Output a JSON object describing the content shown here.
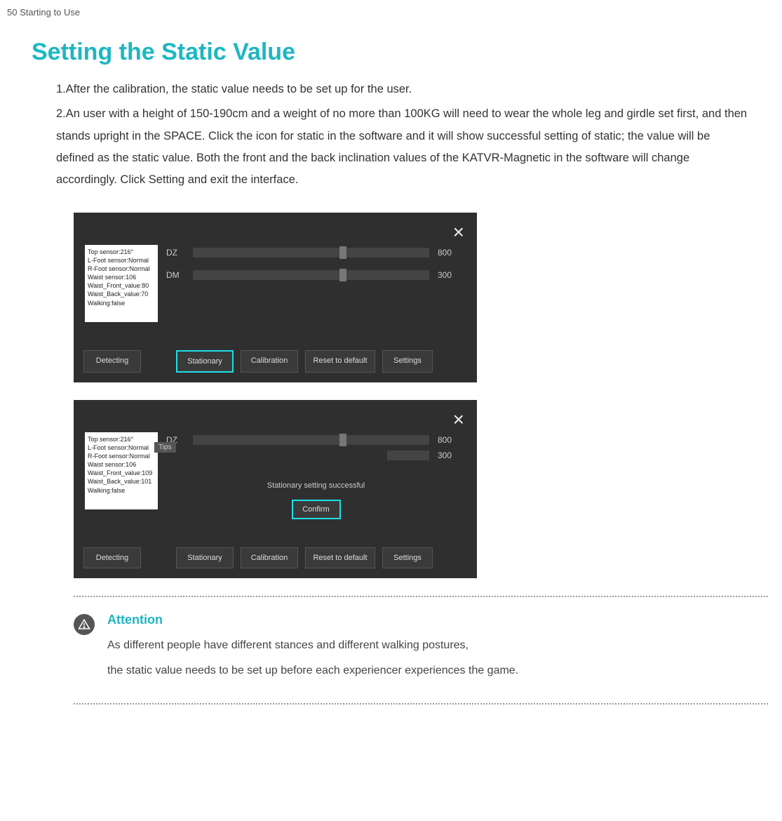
{
  "page_header": "50  Starting to Use",
  "title": "Setting the Static Value",
  "step1": "1.After the calibration, the static value needs to be set up for the user.",
  "step2": "2.An user with a height of 150-190cm and a weight of no more than 100KG will need to wear the whole leg and girdle set first, and then stands upright in the SPACE. Click the icon for static in the software and it will show successful setting of static; the value will be defined as the static value. Both the front and the back inclination values of the KATVR-Magnetic  in the software will change accordingly. Click Setting and exit the interface.",
  "panel_a": {
    "sensors": [
      "Top sensor:216°",
      "L-Foot sensor:Normal",
      "R-Foot sensor:Normal",
      "Waist sensor:106",
      "Waist_Front_value:80",
      "Waist_Back_value:70",
      "Walking:false"
    ],
    "dz_label": "DZ",
    "dz_value": "800",
    "dm_label": "DM",
    "dm_value": "300",
    "buttons": {
      "detecting": "Detecting",
      "stationary": "Stationary",
      "calibration": "Calibration",
      "reset": "Reset to default",
      "settings": "Settings"
    }
  },
  "panel_b": {
    "sensors": [
      "Top sensor:216°",
      "L-Foot sensor:Normal",
      "R-Foot sensor:Normal",
      "Waist sensor:106",
      "Waist_Front_value:109",
      "Waist_Back_value:101",
      "Walking:false"
    ],
    "dz_label": "DZ",
    "dz_value": "800",
    "dm_value": "300",
    "tips_tag": "Tips",
    "modal_msg": "Stationary setting successful",
    "confirm": "Confirm",
    "buttons": {
      "detecting": "Detecting",
      "stationary": "Stationary",
      "calibration": "Calibration",
      "reset": "Reset to default",
      "settings": "Settings"
    }
  },
  "attention": {
    "heading": "Attention",
    "line1": "As different people have different stances and different walking postures,",
    "line2": "the static value needs to be set up before each experiencer experiences the game."
  }
}
